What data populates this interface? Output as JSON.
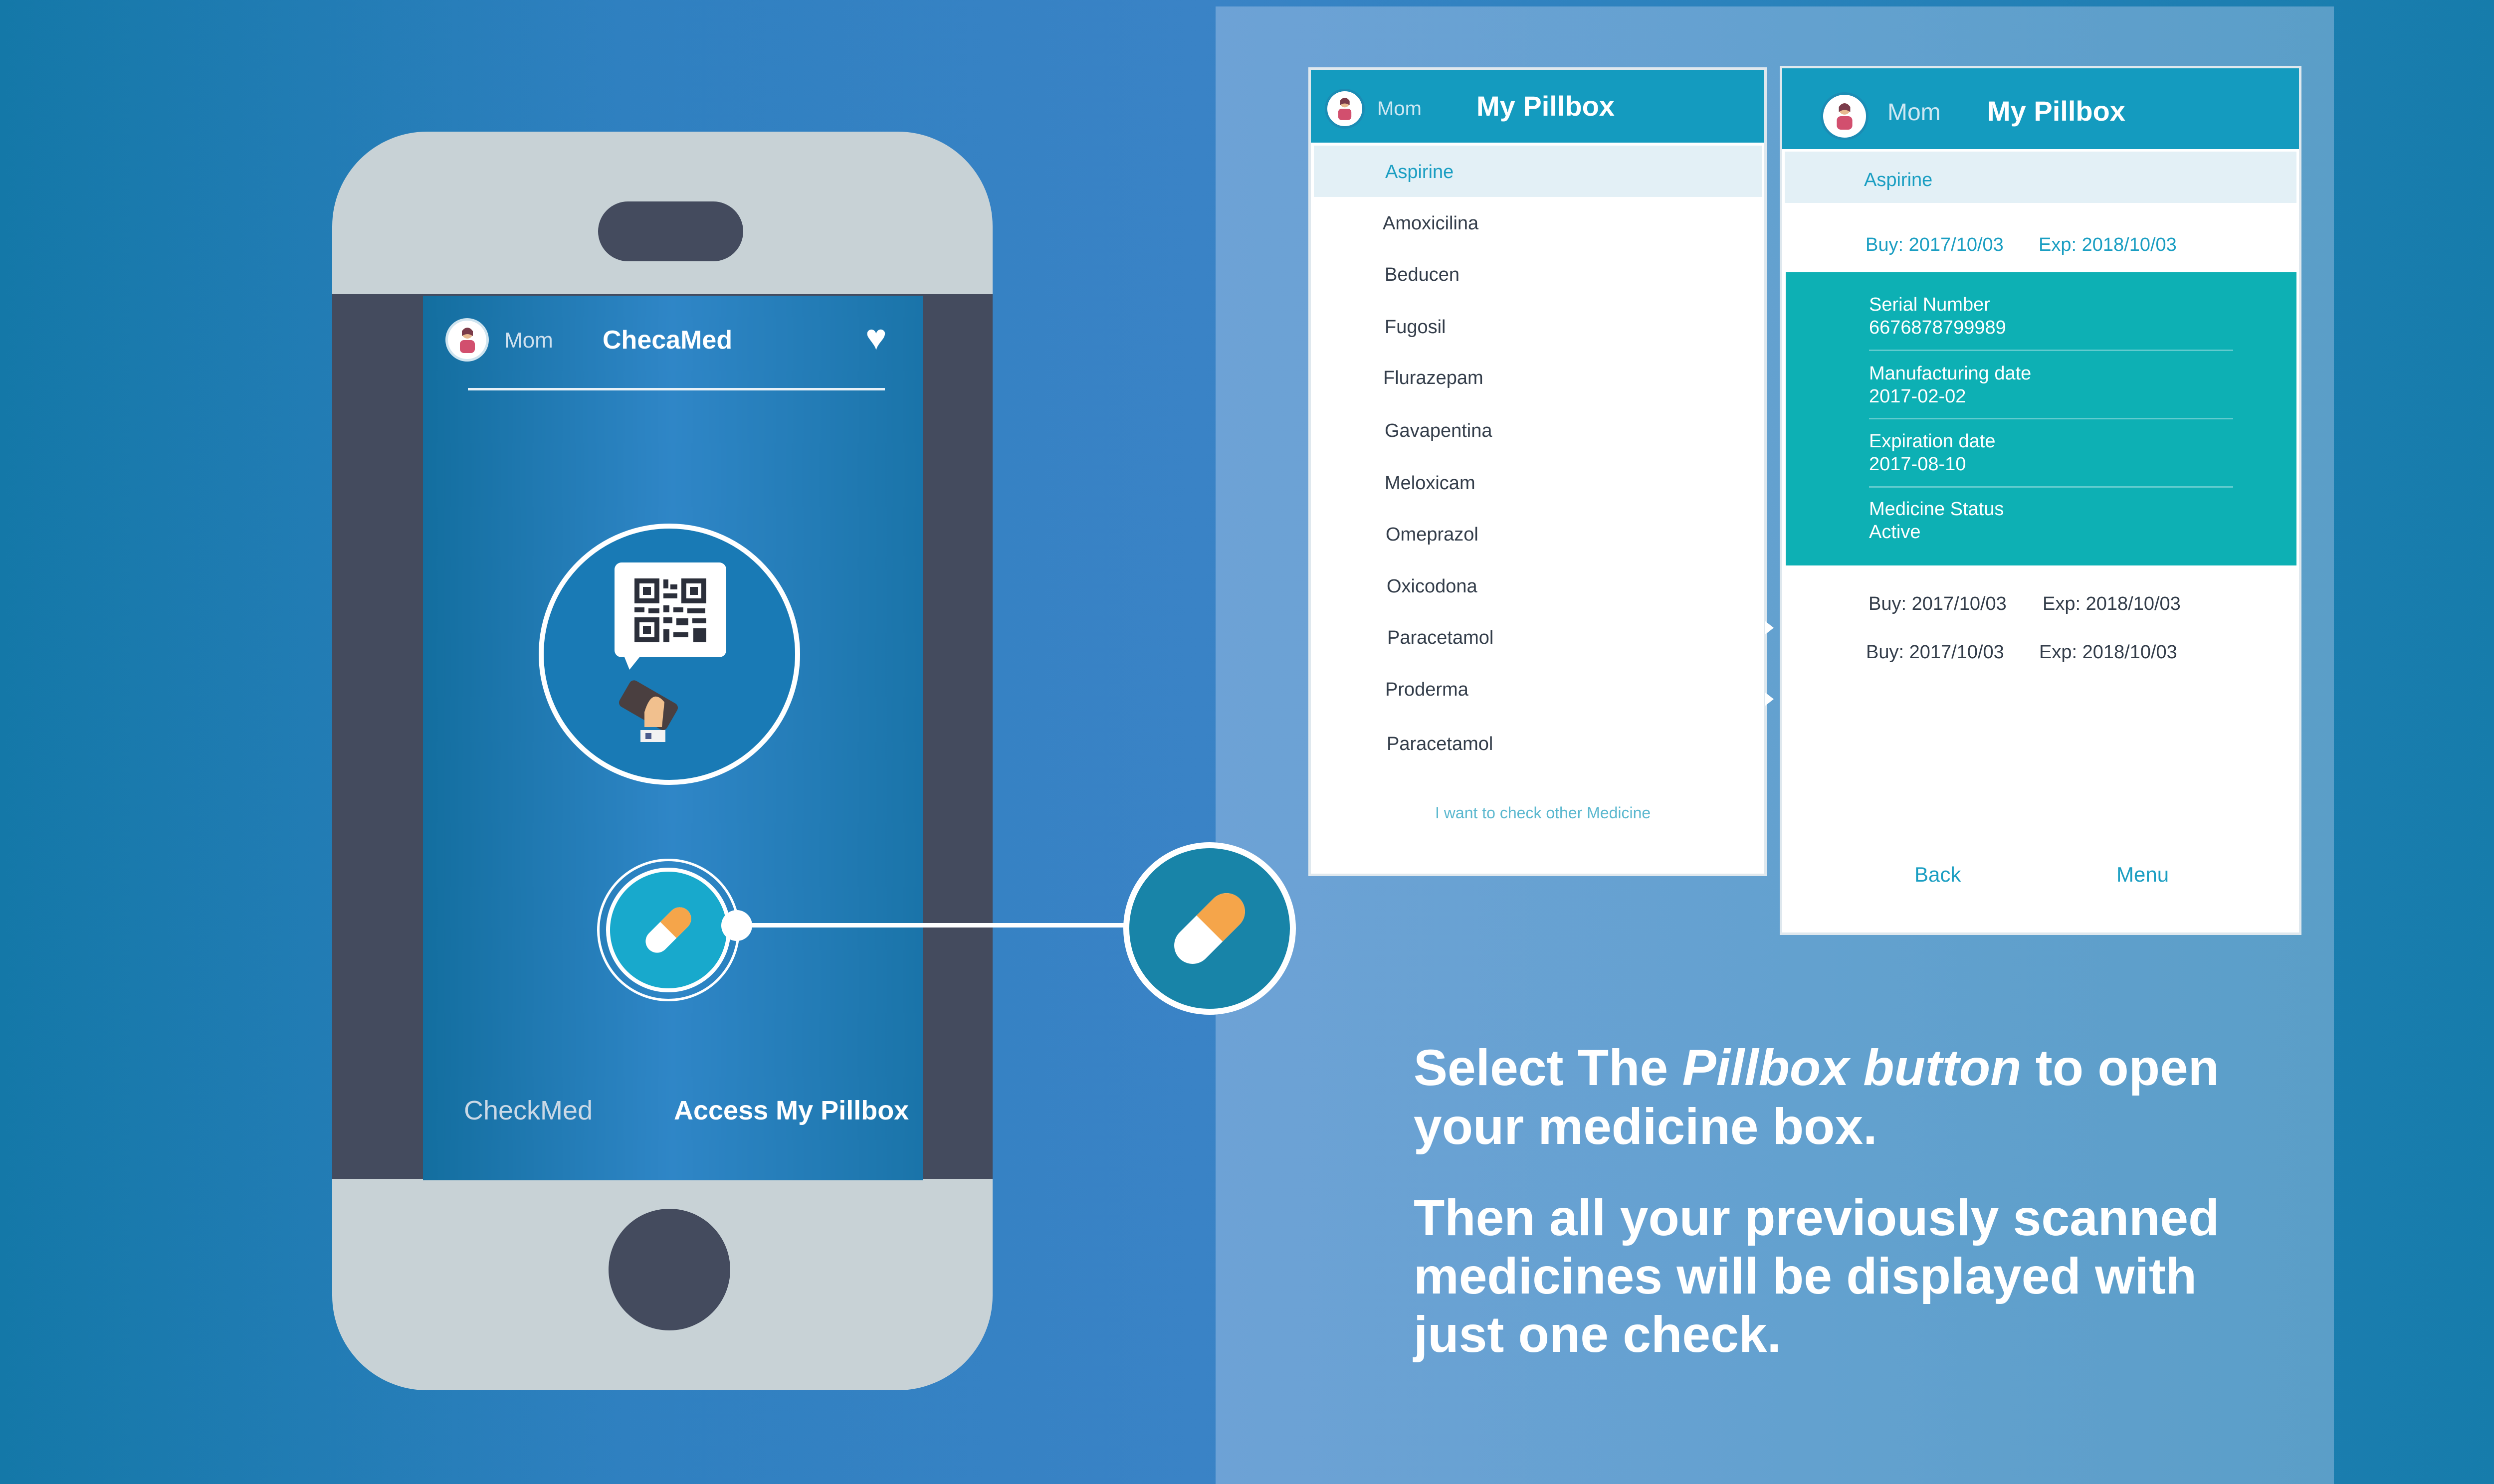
{
  "phone": {
    "profile_name": "Mom",
    "app_title": "ChecaMed",
    "bottom_nav": {
      "checkmed": "CheckMed",
      "access_pillbox": "Access My Pillbox"
    }
  },
  "pillbox_list": {
    "profile_name": "Mom",
    "title": "My Pillbox",
    "items": [
      "Aspirine",
      "Amoxicilina",
      "Beducen",
      "Fugosil",
      "Flurazepam",
      "Gavapentina",
      "Meloxicam",
      "Omeprazol",
      "Oxicodona",
      "Paracetamol",
      "Proderma",
      "Paracetamol"
    ],
    "selected_index": 0,
    "footer_link": "I want to check other Medicine"
  },
  "pillbox_detail": {
    "profile_name": "Mom",
    "title": "My Pillbox",
    "medicine": "Aspirine",
    "buy": "Buy: 2017/10/03",
    "exp": "Exp: 2018/10/03",
    "info": [
      {
        "label": "Serial Number",
        "value": "6676878799989"
      },
      {
        "label": "Manufacturing date",
        "value": "2017-02-02"
      },
      {
        "label": "Expiration date",
        "value": "2017-08-10"
      },
      {
        "label": "Medicine Status",
        "value": "Active"
      }
    ],
    "history": [
      {
        "buy": "Buy: 2017/10/03",
        "exp": "Exp: 2018/10/03"
      },
      {
        "buy": "Buy: 2017/10/03",
        "exp": "Exp: 2018/10/03"
      }
    ],
    "back_label": "Back",
    "menu_label": "Menu"
  },
  "caption": {
    "line1_prefix": "Select The ",
    "line1_emph": "Pillbox button",
    "line1_suffix": " to open",
    "line2": "your medicine box.",
    "para2_line1": "Then all your previously scanned",
    "para2_line2": "medicines will be displayed with",
    "para2_line3": "just one check."
  },
  "colors": {
    "brand_teal": "#149bbf",
    "info_teal": "#0db0b4",
    "pill_orange": "#f5a54a",
    "phone_gray": "#c8d2d6",
    "phone_dark": "#444b5e"
  },
  "icons": [
    "avatar-icon",
    "heart-icon",
    "qr-scan-icon",
    "pill-icon"
  ]
}
